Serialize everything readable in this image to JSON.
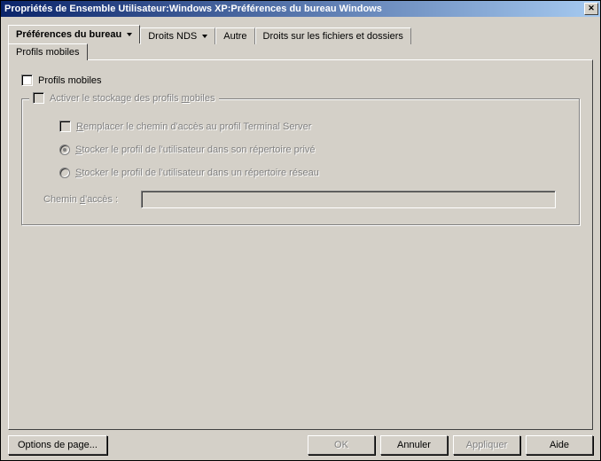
{
  "window": {
    "title": "Propriétés de Ensemble Utilisateur:Windows XP:Préférences du bureau Windows",
    "close_symbol": "✕"
  },
  "tabs": {
    "t0": "Préférences du bureau",
    "t1": "Droits NDS",
    "t2": "Autre",
    "t3": "Droits sur les fichiers et dossiers"
  },
  "subtab": {
    "label": "Profils mobiles"
  },
  "section": {
    "main_checkbox": "Profils mobiles",
    "group_legend_prefix": "Activer le stockage des profils ",
    "group_legend_u": "m",
    "group_legend_suffix": "obiles",
    "replace_u": "R",
    "replace_rest": "emplacer le chemin d'accès au profil Terminal Server",
    "store_priv_u": "S",
    "store_priv_rest": "tocker le profil de l'utilisateur dans son répertoire privé",
    "store_net_u": "S",
    "store_net_rest": "tocker le profil de l'utilisateur dans un répertoire réseau",
    "path_label_prefix": "Chemin ",
    "path_label_u": "d",
    "path_label_suffix": "'accès :",
    "path_value": ""
  },
  "buttons": {
    "page_options": "Options de page...",
    "ok": "OK",
    "cancel": "Annuler",
    "apply": "Appliquer",
    "help": "Aide"
  }
}
